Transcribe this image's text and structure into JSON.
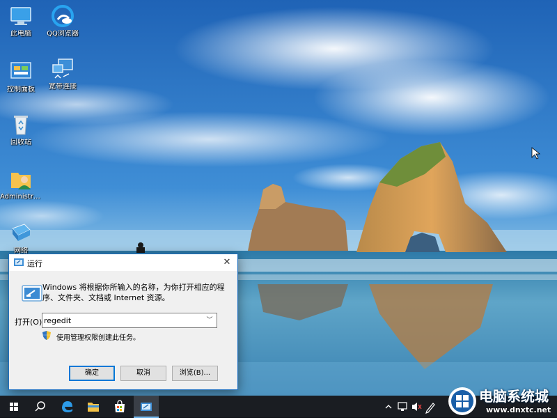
{
  "desktop": {
    "icons": [
      {
        "name": "此电脑",
        "icon": "computer-icon"
      },
      {
        "name": "QQ浏览器",
        "icon": "qq-browser-icon"
      },
      {
        "name": "控制面板",
        "icon": "control-panel-icon"
      },
      {
        "name": "宽带连接",
        "icon": "broadband-connection-icon"
      },
      {
        "name": "回收站",
        "icon": "recycle-bin-icon"
      },
      {
        "name": "Administra...",
        "icon": "user-folder-icon"
      },
      {
        "name": "网络",
        "icon": "network-icon"
      }
    ]
  },
  "run_dialog": {
    "title": "运行",
    "close_symbol": "✕",
    "description": "Windows 将根据你所输入的名称，为你打开相应的程序、文件夹、文档或 Internet 资源。",
    "open_label": "打开(O):",
    "input_value": "regedit",
    "admin_note": "使用管理权限创建此任务。",
    "buttons": {
      "ok": "确定",
      "cancel": "取消",
      "browse": "浏览(B)..."
    }
  },
  "taskbar": {
    "items": [
      "start-icon",
      "search-icon",
      "edge-icon",
      "file-explorer-icon",
      "store-icon",
      "run-app-icon"
    ],
    "tray": [
      "chevron-up-icon",
      "network-tray-icon",
      "volume-muted-icon",
      "pen-icon"
    ]
  },
  "watermark": {
    "text": "电脑系统城",
    "url": "www.dnxtc.net"
  },
  "colors": {
    "accent": "#0078d7",
    "taskbar": "#1a1d22",
    "dialog_bg": "#f0f0f0"
  }
}
